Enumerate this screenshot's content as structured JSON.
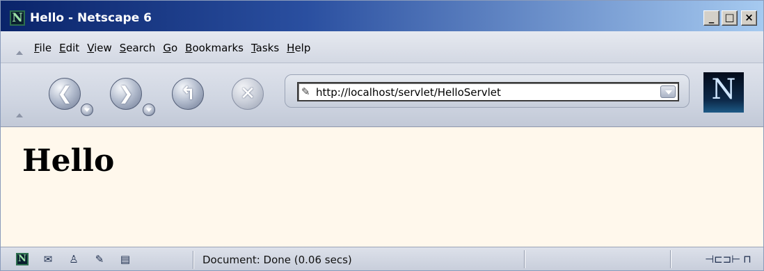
{
  "window": {
    "title": "Hello - Netscape 6",
    "app_icon_letter": "N",
    "buttons": {
      "minimize": "_",
      "maximize": "□",
      "close": "×"
    }
  },
  "menubar": {
    "items": [
      {
        "u": "F",
        "rest": "ile"
      },
      {
        "u": "E",
        "rest": "dit"
      },
      {
        "u": "V",
        "rest": "iew"
      },
      {
        "u": "S",
        "rest": "earch"
      },
      {
        "u": "G",
        "rest": "o"
      },
      {
        "u": "B",
        "rest": "ookmarks"
      },
      {
        "u": "T",
        "rest": "asks"
      },
      {
        "u": "H",
        "rest": "elp"
      }
    ]
  },
  "navbar": {
    "back_glyph": "❮",
    "forward_glyph": "❯",
    "reload_glyph": "↰",
    "stop_glyph": "✕",
    "url": "http://localhost/servlet/HelloServlet",
    "throbber_letter": "N"
  },
  "content": {
    "heading": "Hello"
  },
  "statusbar": {
    "text": "Document: Done (0.06 secs)",
    "left_icons": [
      "netscape-icon",
      "mail-icon",
      "instant-messenger-icon",
      "composer-icon",
      "address-book-icon"
    ],
    "right_icons": [
      "online-icon",
      "security-lock-icon"
    ]
  },
  "colors": {
    "title_gradient_start": "#0a246a",
    "title_gradient_end": "#a6caf0",
    "content_background": "#fff8ec"
  }
}
